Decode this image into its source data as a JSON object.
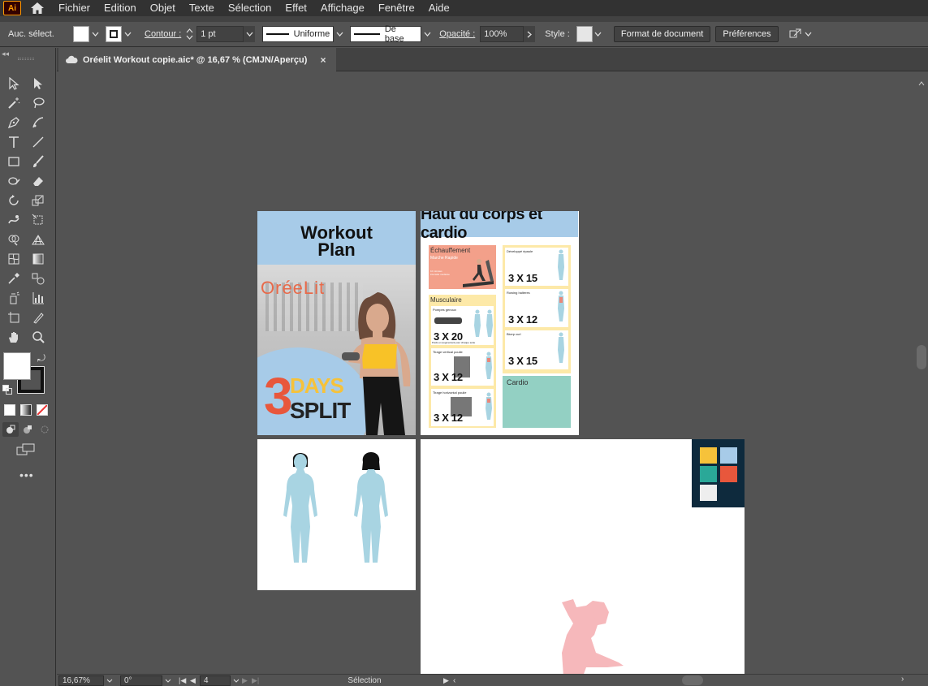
{
  "menubar": {
    "logo": "Ai",
    "items": [
      "Fichier",
      "Edition",
      "Objet",
      "Texte",
      "Sélection",
      "Effet",
      "Affichage",
      "Fenêtre",
      "Aide"
    ]
  },
  "controlbar": {
    "selection_label": "Auc. sélect.",
    "contour_label": "Contour :",
    "stroke_weight": "1 pt",
    "stroke_profile": "Uniforme",
    "brush": "De base",
    "opacity_label": "Opacité :",
    "opacity_value": "100%",
    "style_label": "Style :",
    "doc_setup_button": "Format de document",
    "prefs_button": "Préférences"
  },
  "document_tab": {
    "title": "Oréelit Workout copie.aic* @ 16,67 % (CMJN/Aperçu)",
    "close": "×"
  },
  "statusbar": {
    "zoom": "16,67%",
    "rotation": "0°",
    "artboard_index": "4",
    "tool_name": "Sélection"
  },
  "artboard1": {
    "title_line1": "Workout",
    "title_line2": "Plan",
    "brand": "OréeLit",
    "badge_number": "3",
    "badge_word1": "DAYS",
    "badge_word2": "SPLIT"
  },
  "artboard2": {
    "title": "Haut du corps et cardio",
    "warmup_heading": "Échauffement",
    "warmup_sub": "Marche Rapide",
    "warmup_detail": "10 minutes\nintensité modérée",
    "muscle_heading": "Musculaire",
    "ex1_name": "Pompes genoux",
    "ex1_sets": "3 X 20",
    "ex1_note": "Poids en augmentant pour chaque série",
    "ex2_name": "Tirage vertical poulie",
    "ex2_sets": "3 X 12",
    "ex3_name": "Tirage horizontal poulie",
    "ex3_sets": "3 X 12",
    "ex4_name": "Développé épaule",
    "ex4_sets": "3 X 15",
    "ex5_name": "Rowing haltères",
    "ex5_sets": "3 X 12",
    "ex6_name": "Bicep curl",
    "ex6_sets": "3 X 15",
    "cardio_heading": "Cardio"
  },
  "palette": {
    "colors": [
      "#f6c23a",
      "#a7cbe8",
      "#2aa898",
      "#e8573c",
      "#eeeeee"
    ]
  },
  "colors": {
    "app_bg": "#535353",
    "menubar_bg": "#323232",
    "accent_orange": "#e86a4a",
    "yellow": "#f6c23a",
    "light_blue": "#a7cbe8",
    "mint": "#93d0c3",
    "salmon": "#f3a08a",
    "cream": "#fde9a8",
    "navy": "#0e2a3d"
  }
}
